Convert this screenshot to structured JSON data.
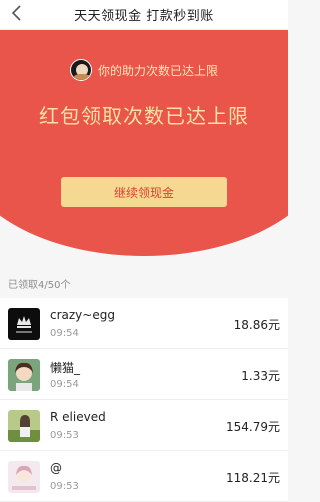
{
  "header": {
    "title": "天天领现金 打款秒到账"
  },
  "banner": {
    "helper_text": "你的助力次数已达上限",
    "headline": "红包领取次数已达上限",
    "button_label": "继续领现金",
    "bg_color": "#e9544b",
    "button_color": "#f5d992"
  },
  "records": {
    "count_text": "已领取4/50个",
    "items": [
      {
        "name": "crazy~egg",
        "time": "09:54",
        "amount": "18.86元",
        "avatar": "black-crown-logo"
      },
      {
        "name": "懒猫_",
        "time": "09:54",
        "amount": "1.33元",
        "avatar": "cartoon-girl"
      },
      {
        "name": "R elieved",
        "time": "09:53",
        "amount": "154.79元",
        "avatar": "girl-outdoors"
      },
      {
        "name": "@",
        "time": "09:53",
        "amount": "118.21元",
        "avatar": "anime-girl"
      }
    ]
  }
}
